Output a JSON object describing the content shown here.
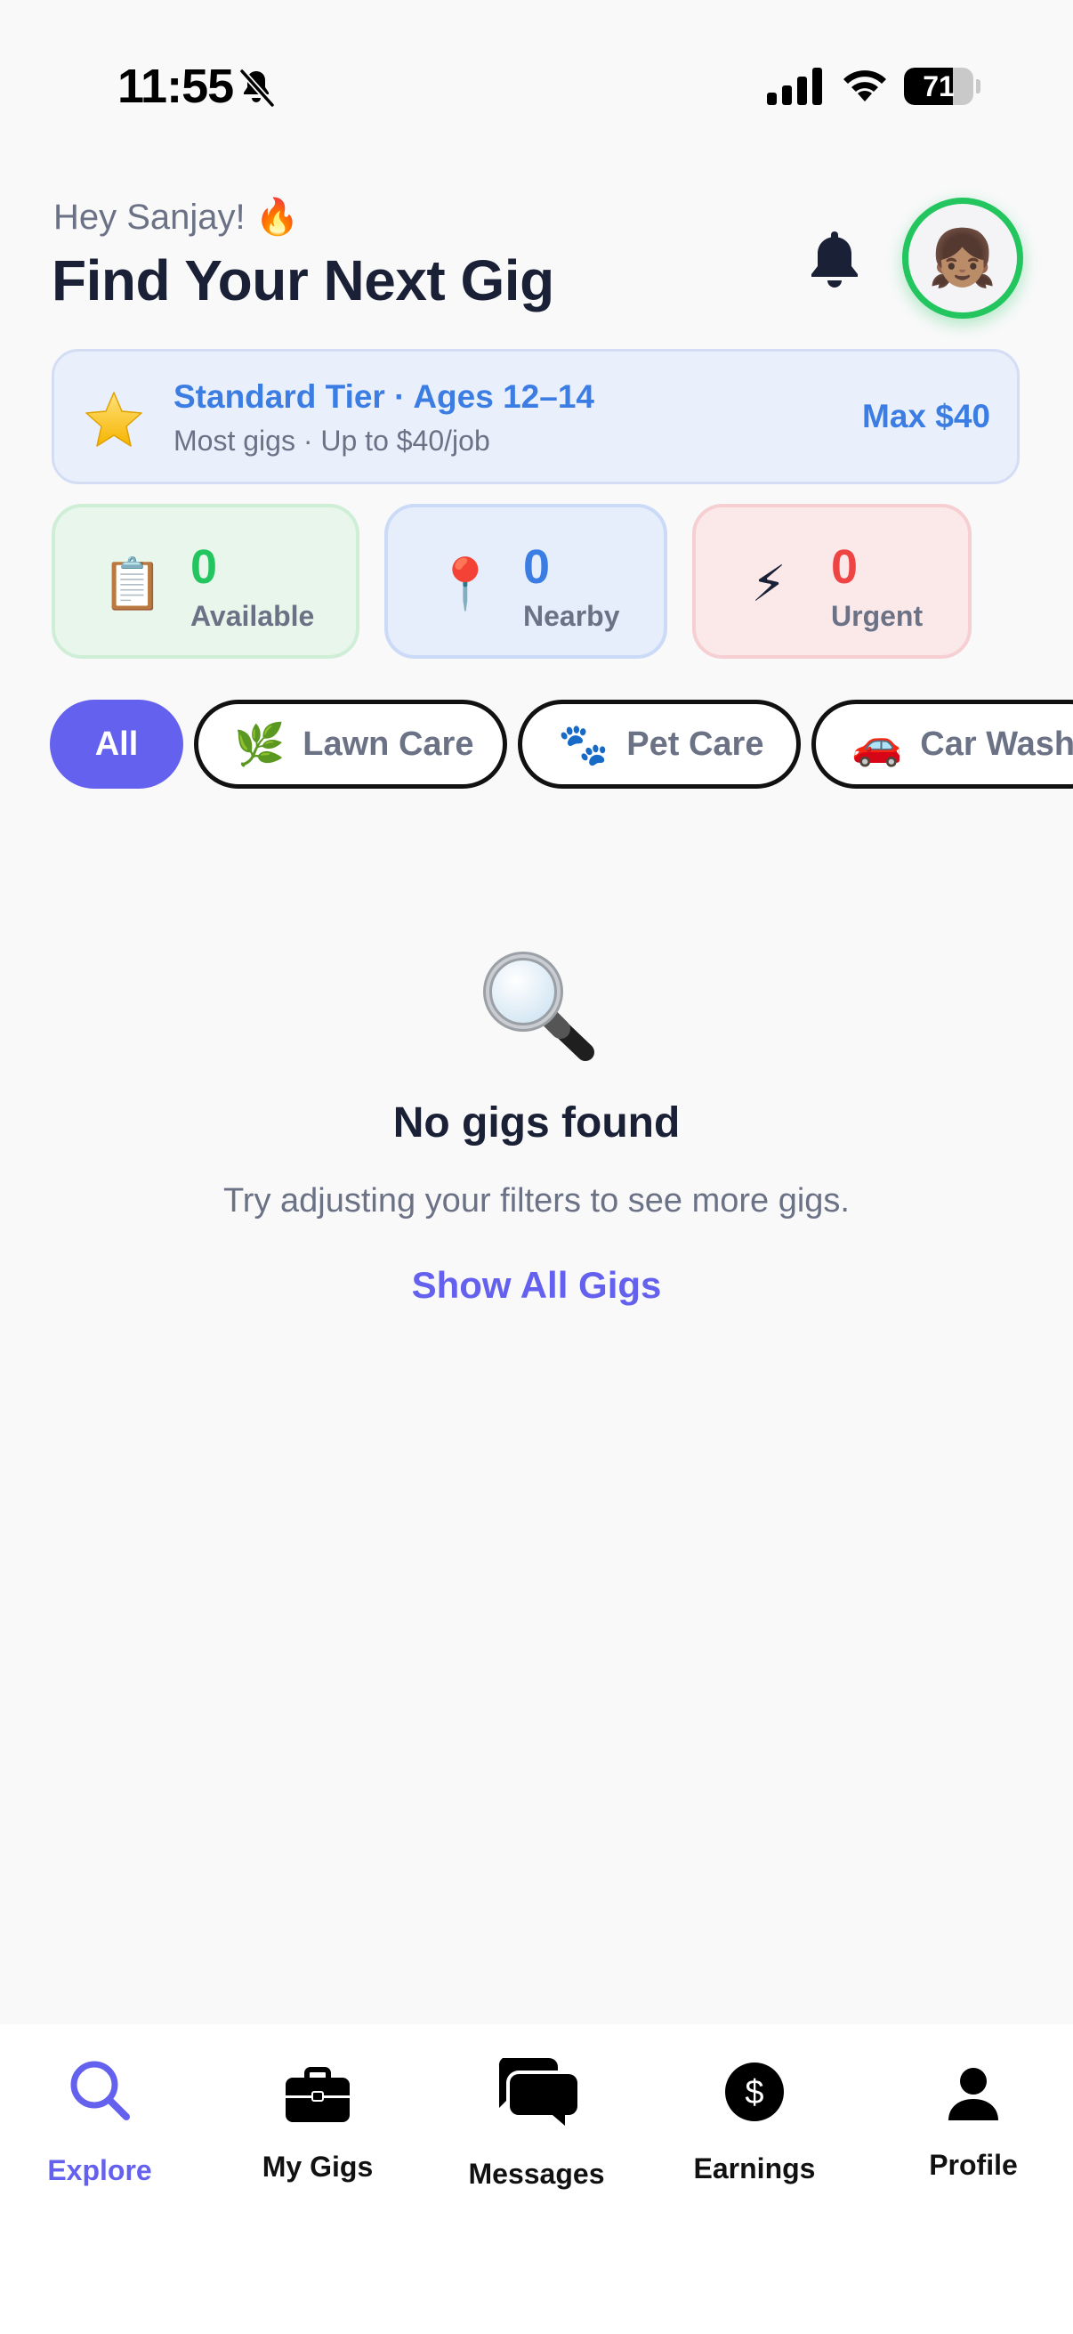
{
  "status_bar": {
    "time": "11:55",
    "battery_percent": 71
  },
  "header": {
    "greeting": "Hey Sanjay! 🔥",
    "title": "Find Your Next Gig",
    "avatar_emoji": "👧🏽"
  },
  "tier": {
    "title": "Standard Tier · Ages 12–14",
    "subtitle": "Most gigs · Up to $40/job",
    "max": "Max $40"
  },
  "stats": [
    {
      "icon": "📋",
      "value": "0",
      "label": "Available",
      "color": "#22c55e"
    },
    {
      "icon": "📍",
      "value": "0",
      "label": "Nearby",
      "color": "#3b7de3"
    },
    {
      "icon": "⚡",
      "value": "0",
      "label": "Urgent",
      "color": "#ef4444"
    }
  ],
  "filters": [
    {
      "label": "All",
      "selected": true
    },
    {
      "icon": "🌿",
      "label": "Lawn Care",
      "selected": false
    },
    {
      "icon": "🐾",
      "label": "Pet Care",
      "selected": false
    },
    {
      "icon": "🚗",
      "label": "Car Wash",
      "selected": false
    }
  ],
  "empty_state": {
    "icon": "magnifying-glass-icon",
    "title": "No gigs found",
    "subtitle": "Try adjusting your filters to see more gigs.",
    "action": "Show All Gigs"
  },
  "tabbar": {
    "items": [
      {
        "label": "Explore",
        "icon": "search-icon",
        "active": true
      },
      {
        "label": "My Gigs",
        "icon": "briefcase-icon",
        "active": false
      },
      {
        "label": "Messages",
        "icon": "chat-bubbles-icon",
        "active": false
      },
      {
        "label": "Earnings",
        "icon": "dollar-circle-icon",
        "active": false
      },
      {
        "label": "Profile",
        "icon": "person-icon",
        "active": false
      }
    ]
  },
  "colors": {
    "accent": "#6461ef",
    "tier_blue": "#3b7de3",
    "active_ring": "#22c55e"
  }
}
